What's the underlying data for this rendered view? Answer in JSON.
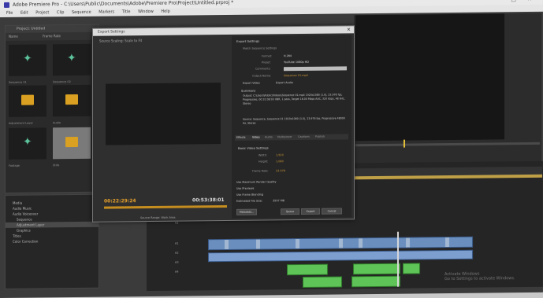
{
  "window": {
    "title": "Adobe Premiere Pro - C:\\Users\\Public\\Documents\\Adobe\\Premiere Pro\\Project\\Untitled.prproj *",
    "controls": "– □ ✕"
  },
  "menu": [
    "File",
    "Edit",
    "Project",
    "Clip",
    "Sequence",
    "Markers",
    "Title",
    "Window",
    "Help"
  ],
  "project_panel": {
    "tab": "Project: Untitled",
    "columns": [
      "Name",
      "Frame Rate"
    ],
    "items": [
      {
        "name": "Sequence 01",
        "kind": "sequence"
      },
      {
        "name": "Adjustment Layer",
        "kind": "folder"
      },
      {
        "name": "Footage",
        "kind": "folder"
      },
      {
        "name": "Audio",
        "kind": "folder"
      },
      {
        "name": "Sequence 02",
        "kind": "sequence"
      },
      {
        "name": "Stills",
        "kind": "folder"
      }
    ]
  },
  "bin_panel": {
    "items": [
      "Media",
      "Audio Music",
      "Audio Voiceover",
      "Sequence",
      "Adjustment Layer",
      "Graphics",
      "Titles",
      "Color Correction"
    ]
  },
  "export_dialog": {
    "title": "Export Settings",
    "close": "✕",
    "source_tab": "Source Scaling: Scale to Fit",
    "timecode_in": "00:22:29:24",
    "timecode_out": "00:53:38:01",
    "source_range": "Source Range: Work Area",
    "settings": {
      "header": "Export Settings",
      "match_sequence": "Match Sequence Settings",
      "format_label": "Format:",
      "format_value": "H.264",
      "preset_label": "Preset:",
      "preset_value": "YouTube 1080p HD",
      "comments_label": "Comments:",
      "output_name_label": "Output Name:",
      "output_name_value": "Sequence 01.mp4",
      "export_video": "Export Video",
      "export_audio": "Export Audio",
      "summary_header": "Summary",
      "summary_output": "Output: C:\\Users\\Public\\Videos\\Sequence 01.mp4 1920x1080 (1.0), 23.976 fps, Progressive, 00:31:08:03 VBR, 1 pass, Target 16.00 Mbps AAC, 320 kbps, 48 kHz, Stereo",
      "summary_source": "Source: Sequence, Sequence 01 1920x1080 (1.0), 23.976 fps, Progressive 48000 Hz, Stereo",
      "tabs": [
        "Effects",
        "Video",
        "Audio",
        "Multiplexer",
        "Captions",
        "Publish"
      ],
      "basic_video_header": "Basic Video Settings",
      "width_label": "Width:",
      "width_value": "1,920",
      "height_label": "Height:",
      "height_value": "1,080",
      "frame_rate_label": "Frame Rate:",
      "frame_rate_value": "23.976",
      "max_render": "Use Maximum Render Quality",
      "use_previews": "Use Previews",
      "use_frame_blending": "Use Frame Blending",
      "file_size_label": "Estimated File Size:",
      "file_size_value": "3597 MB",
      "metadata_button": "Metadata...",
      "queue_button": "Queue",
      "export_button": "Export",
      "cancel_button": "Cancel"
    }
  },
  "timeline": {
    "tracks": [
      "V3",
      "V2",
      "V1",
      "A1",
      "A2",
      "A3",
      "A4"
    ]
  },
  "watermark": "Activate Windows\nGo to Settings to activate Windows.",
  "colors": {
    "accent": "#e8a22c",
    "video_clip": "#6a8fbf",
    "audio_clip": "#5ec457",
    "folder": "#d9a021"
  }
}
